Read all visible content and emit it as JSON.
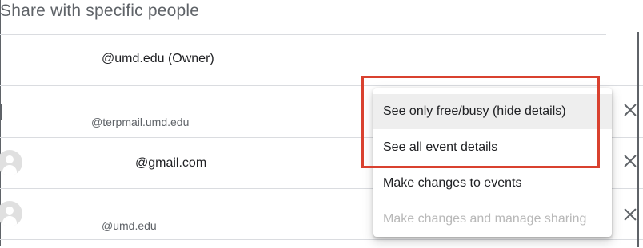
{
  "section": {
    "title": "Share with specific people"
  },
  "people": [
    {
      "email": "@umd.edu (Owner)"
    },
    {
      "email": "@terpmail.umd.edu"
    },
    {
      "email": "@gmail.com"
    },
    {
      "email": "@umd.edu"
    }
  ],
  "permission_menu": {
    "items": [
      {
        "label": "See only free/busy (hide details)",
        "state": "highlighted"
      },
      {
        "label": "See all event details",
        "state": "normal"
      },
      {
        "label": "Make changes to events",
        "state": "normal"
      },
      {
        "label": "Make changes and manage sharing",
        "state": "disabled"
      }
    ]
  },
  "icons": {
    "avatar": "person-avatar-icon",
    "remove": "close-icon"
  },
  "colors": {
    "annotation_box": "#d9412f",
    "disabled_text": "#b8b8b8",
    "menu_hover": "#eeeeee"
  }
}
